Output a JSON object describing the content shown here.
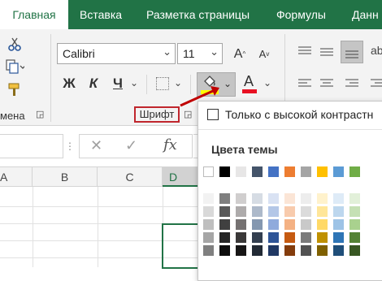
{
  "ribbon_tabs": {
    "home": "Главная",
    "insert": "Вставка",
    "page_layout": "Разметка страницы",
    "formulas": "Формулы",
    "data": "Данн"
  },
  "clipboard": {
    "label": "мена",
    "paste_icon": "scissors-icon",
    "copy_icon": "copy-icon",
    "format_painter_icon": "format-painter-icon"
  },
  "font": {
    "family": "Calibri",
    "size": "11",
    "increase_label": "A",
    "decrease_label": "A",
    "bold_label": "Ж",
    "italic_label": "К",
    "underline_label": "Ч",
    "font_color_label": "A",
    "group_label": "Шрифт",
    "fill_indicator_color": "#ffff00",
    "font_color_indicator": "#e81123"
  },
  "formula_bar": {
    "cancel_icon": "✕",
    "enter_icon": "✓",
    "fx_label": "fx"
  },
  "grid": {
    "columns": [
      "A",
      "B",
      "C",
      "D"
    ]
  },
  "fill_popup": {
    "high_contrast_label": "Только с высокой контрастн",
    "theme_colors_title": "Цвета темы",
    "theme_top_row": [
      "#ffffff",
      "#000000",
      "#e7e6e6",
      "#44546a",
      "#4472c4",
      "#ed7d31",
      "#a5a5a5",
      "#ffc000",
      "#5b9bd5",
      "#70ad47"
    ],
    "theme_shades": [
      [
        "#f2f2f2",
        "#7f7f7f",
        "#d0cece",
        "#d6dce4",
        "#d9e2f3",
        "#fbe5d6",
        "#ededed",
        "#fff2cc",
        "#deebf7",
        "#e2f0d9"
      ],
      [
        "#d9d9d9",
        "#595959",
        "#aeabab",
        "#adb9ca",
        "#b4c7e7",
        "#f8cbad",
        "#dbdbdb",
        "#ffe699",
        "#bdd7ee",
        "#c5e0b4"
      ],
      [
        "#bfbfbf",
        "#404040",
        "#757171",
        "#8497b0",
        "#8faadc",
        "#f4b183",
        "#c9c9c9",
        "#ffd966",
        "#9dc3e6",
        "#a9d18e"
      ],
      [
        "#a6a6a6",
        "#262626",
        "#3a3838",
        "#333f50",
        "#2f5597",
        "#c55a11",
        "#7b7b7b",
        "#bf9000",
        "#2e75b6",
        "#548235"
      ],
      [
        "#808080",
        "#0d0d0d",
        "#171616",
        "#222a35",
        "#203864",
        "#843c0c",
        "#525252",
        "#7f6000",
        "#1f4e79",
        "#385723"
      ]
    ]
  },
  "colors": {
    "accent": "#217346",
    "arrow": "#c00000"
  }
}
